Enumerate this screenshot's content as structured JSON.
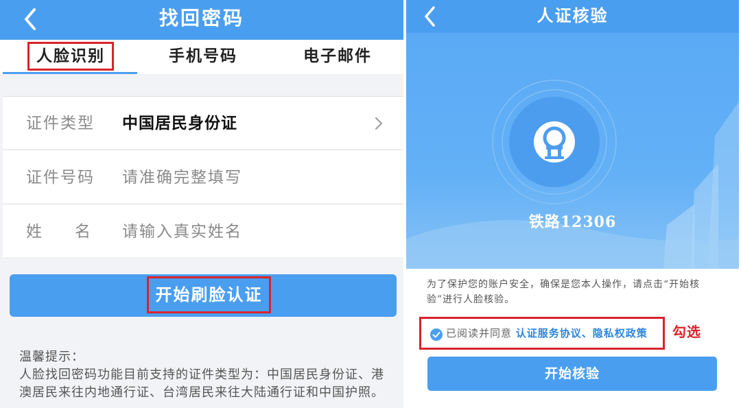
{
  "colors": {
    "accent": "#4a9ef0",
    "highlight_red": "#d9232b",
    "link": "#2f86db"
  },
  "left": {
    "title": "找回密码",
    "back_icon": "chevron-left-icon",
    "tabs": [
      {
        "label": "人脸识别",
        "active": true
      },
      {
        "label": "手机号码",
        "active": false
      },
      {
        "label": "电子邮件",
        "active": false
      }
    ],
    "form": {
      "doc_type_label": "证件类型",
      "doc_type_value": "中国居民身份证",
      "doc_number_label": "证件号码",
      "doc_number_placeholder": "请准确完整填写",
      "name_label": "姓名",
      "name_placeholder": "请输入真实姓名"
    },
    "start_button": "开始刷脸认证",
    "tips_title": "温馨提示：",
    "tips_body": "人脸找回密码功能目前支持的证件类型为：中国居民身份证、港澳居民来往内地通行证、台湾居民来往大陆通行证和中国护照。"
  },
  "right": {
    "title": "人证核验",
    "back_icon": "chevron-left-icon",
    "logo_icon": "railway-logo-icon",
    "brand": "铁路12306",
    "notice": "为了保护您的账户安全，确保是您本人操作，请点击“开始核验”进行人脸核验。",
    "agree_checked": true,
    "agree_prefix": "已阅读并同意",
    "agree_links": "认证服务协议、隐私权政策",
    "annotation": "勾选",
    "verify_button": "开始核验"
  }
}
